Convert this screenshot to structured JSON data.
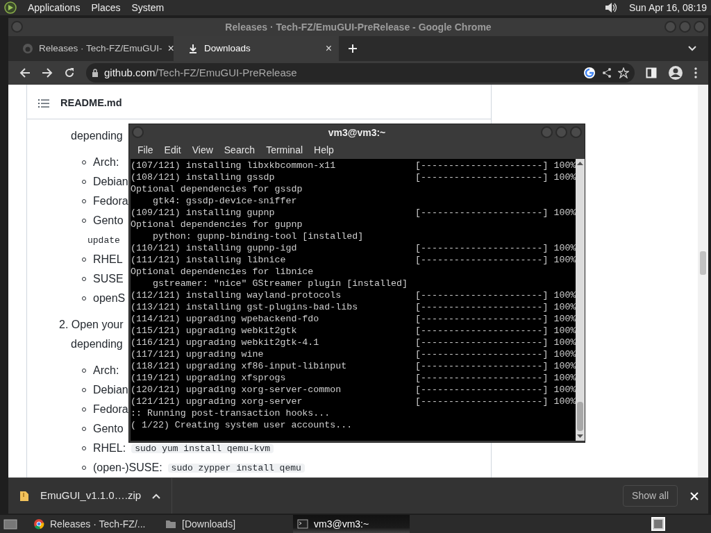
{
  "top_panel": {
    "menus": [
      "Applications",
      "Places",
      "System"
    ],
    "clock": "Sun Apr 16, 08:19"
  },
  "browser": {
    "title": "Releases · Tech-FZ/EmuGUI-PreRelease - Google Chrome",
    "tabs": [
      {
        "label": "Releases · Tech-FZ/EmuGUI-",
        "selected": false,
        "kind": "github",
        "close": "×"
      },
      {
        "label": "Downloads",
        "selected": true,
        "kind": "download",
        "close": "×"
      }
    ],
    "address": {
      "domain": "github.com",
      "path": "/Tech-FZ/EmuGUI-PreRelease"
    },
    "readme": {
      "title": "README.md",
      "items": [
        {
          "kind": "line",
          "text": "depending"
        },
        {
          "kind": "bullet",
          "text": "Arch:"
        },
        {
          "kind": "bullet",
          "text": "Debian"
        },
        {
          "kind": "bullet",
          "text": "Fedora"
        },
        {
          "kind": "bullet",
          "text": "Gento"
        },
        {
          "kind": "code_line",
          "code": "update"
        },
        {
          "kind": "bullet",
          "text": "RHEL"
        },
        {
          "kind": "bullet",
          "text": "SUSE"
        },
        {
          "kind": "bullet",
          "text": "openS"
        },
        {
          "kind": "step",
          "text": "2. Open your"
        },
        {
          "kind": "line",
          "text": "depending"
        },
        {
          "kind": "bullet",
          "text": "Arch:"
        },
        {
          "kind": "bullet",
          "text": "Debian"
        },
        {
          "kind": "bullet",
          "text": "Fedora"
        },
        {
          "kind": "bullet",
          "text": "Gento"
        },
        {
          "kind": "bullet",
          "text": "RHEL:",
          "code": "sudo yum install qemu-kvm"
        },
        {
          "kind": "bullet",
          "text": "(open-)SUSE:",
          "code": "sudo zypper install qemu"
        }
      ]
    },
    "downloads_bar": {
      "file": "EmuGUI_v1.1.0….zip",
      "show_all": "Show all"
    }
  },
  "terminal": {
    "title": "vm3@vm3:~",
    "menus": [
      "File",
      "Edit",
      "View",
      "Search",
      "Terminal",
      "Help"
    ],
    "lines": [
      {
        "kind": "progress",
        "text": "(107/121) installing libxkbcommon-x11",
        "bar": "[----------------------]",
        "percent": "100%"
      },
      {
        "kind": "progress",
        "text": "(108/121) installing gssdp",
        "bar": "[----------------------]",
        "percent": "100%"
      },
      {
        "kind": "plain",
        "text": "Optional dependencies for gssdp"
      },
      {
        "kind": "plain",
        "text": "    gtk4: gssdp-device-sniffer"
      },
      {
        "kind": "progress",
        "text": "(109/121) installing gupnp",
        "bar": "[----------------------]",
        "percent": "100%"
      },
      {
        "kind": "plain",
        "text": "Optional dependencies for gupnp"
      },
      {
        "kind": "plain",
        "text": "    python: gupnp-binding-tool [installed]"
      },
      {
        "kind": "progress",
        "text": "(110/121) installing gupnp-igd",
        "bar": "[----------------------]",
        "percent": "100%"
      },
      {
        "kind": "progress",
        "text": "(111/121) installing libnice",
        "bar": "[----------------------]",
        "percent": "100%"
      },
      {
        "kind": "plain",
        "text": "Optional dependencies for libnice"
      },
      {
        "kind": "plain",
        "text": "    gstreamer: \"nice\" GStreamer plugin [installed]"
      },
      {
        "kind": "progress",
        "text": "(112/121) installing wayland-protocols",
        "bar": "[----------------------]",
        "percent": "100%"
      },
      {
        "kind": "progress",
        "text": "(113/121) installing gst-plugins-bad-libs",
        "bar": "[----------------------]",
        "percent": "100%"
      },
      {
        "kind": "progress",
        "text": "(114/121) upgrading wpebackend-fdo",
        "bar": "[----------------------]",
        "percent": "100%"
      },
      {
        "kind": "progress",
        "text": "(115/121) upgrading webkit2gtk",
        "bar": "[----------------------]",
        "percent": "100%"
      },
      {
        "kind": "progress",
        "text": "(116/121) upgrading webkit2gtk-4.1",
        "bar": "[----------------------]",
        "percent": "100%"
      },
      {
        "kind": "progress",
        "text": "(117/121) upgrading wine",
        "bar": "[----------------------]",
        "percent": "100%"
      },
      {
        "kind": "progress",
        "text": "(118/121) upgrading xf86-input-libinput",
        "bar": "[----------------------]",
        "percent": "100%"
      },
      {
        "kind": "progress",
        "text": "(119/121) upgrading xfsprogs",
        "bar": "[----------------------]",
        "percent": "100%"
      },
      {
        "kind": "progress",
        "text": "(120/121) upgrading xorg-server-common",
        "bar": "[----------------------]",
        "percent": "100%"
      },
      {
        "kind": "progress",
        "text": "(121/121) upgrading xorg-server",
        "bar": "[----------------------]",
        "percent": "100%"
      },
      {
        "kind": "plain",
        "text": ":: Running post-transaction hooks..."
      },
      {
        "kind": "plain",
        "text": "( 1/22) Creating system user accounts..."
      }
    ]
  },
  "taskbar": {
    "items": [
      {
        "label": "Releases · Tech-FZ/...",
        "selected": false,
        "kind": "chrome"
      },
      {
        "label": "[Downloads]",
        "selected": false,
        "kind": "folder"
      },
      {
        "label": "vm3@vm3:~",
        "selected": true,
        "kind": "terminal"
      }
    ]
  }
}
